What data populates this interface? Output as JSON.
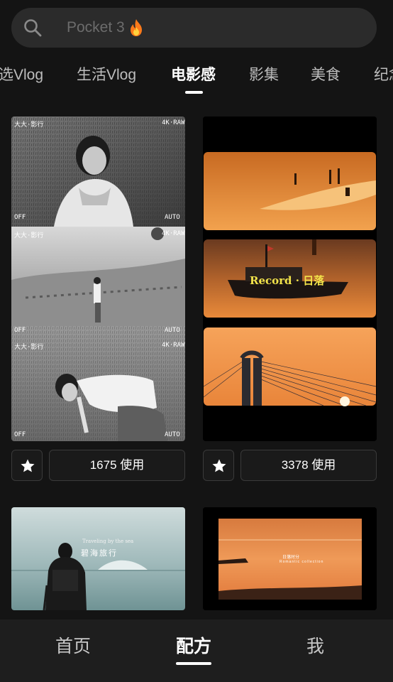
{
  "search": {
    "placeholder": "Pocket 3",
    "icon": "search-icon",
    "suffix_icon": "fire-icon"
  },
  "tabs": [
    {
      "label": "选Vlog"
    },
    {
      "label": "生活Vlog"
    },
    {
      "label": "电影感",
      "active": true
    },
    {
      "label": "影集"
    },
    {
      "label": "美食"
    },
    {
      "label": "纪念"
    }
  ],
  "cards": [
    {
      "hud": {
        "top_left": "大大·影行",
        "mode": "4K·RAW",
        "flash": "OFF",
        "wb": "AUTO"
      },
      "usage": "1675 使用"
    },
    {
      "caption": "Record · 日落",
      "usage": "3378 使用"
    },
    {
      "title": "碧海旅行",
      "subtitle": "Traveling by the sea"
    },
    {
      "title": "日落时分",
      "subtitle": "Romantic collection"
    }
  ],
  "bottom_nav": [
    {
      "label": "首页"
    },
    {
      "label": "配方",
      "active": true
    },
    {
      "label": "我"
    }
  ],
  "colors": {
    "background": "#141414",
    "surface": "#2b2b2b",
    "sunset_accent": "#e98a3a",
    "caption_yellow": "#f2e34a"
  }
}
